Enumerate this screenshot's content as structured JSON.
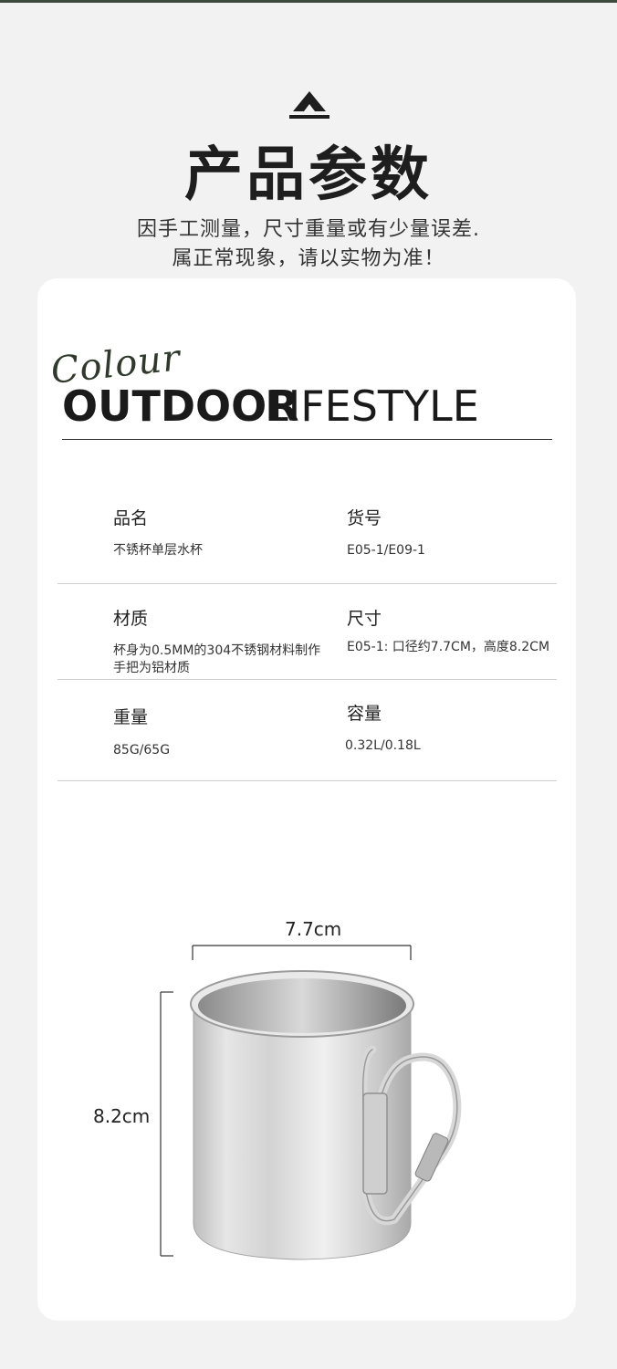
{
  "header": {
    "title": "产品参数",
    "notice_line1": "因手工测量，尺寸重量或有少量误差.",
    "notice_line2": "属正常现象，请以实物为准！",
    "icon": "tent-icon"
  },
  "brand": {
    "script": "Colour",
    "bold": "OUTDOOR",
    "light": "LIFESTYLE"
  },
  "specs": [
    {
      "label": "品名",
      "value": "不锈杯单层水杯"
    },
    {
      "label": "货号",
      "value": "E05-1/E09-1"
    },
    {
      "label": "材质",
      "value": "杯身为0.5MM的304不锈钢材料制作",
      "value2": "手把为铝材质"
    },
    {
      "label": "尺寸",
      "value": "E05-1: 口径约7.7CM，高度8.2CM"
    },
    {
      "label": "重量",
      "value": "85G/65G"
    },
    {
      "label": "容量",
      "value": "0.32L/0.18L"
    }
  ],
  "dimensions": {
    "width": "7.7cm",
    "height": "8.2cm"
  },
  "colors": {
    "background": "#f2f2f2",
    "card": "#ffffff",
    "accent": "#3c4a3e"
  }
}
